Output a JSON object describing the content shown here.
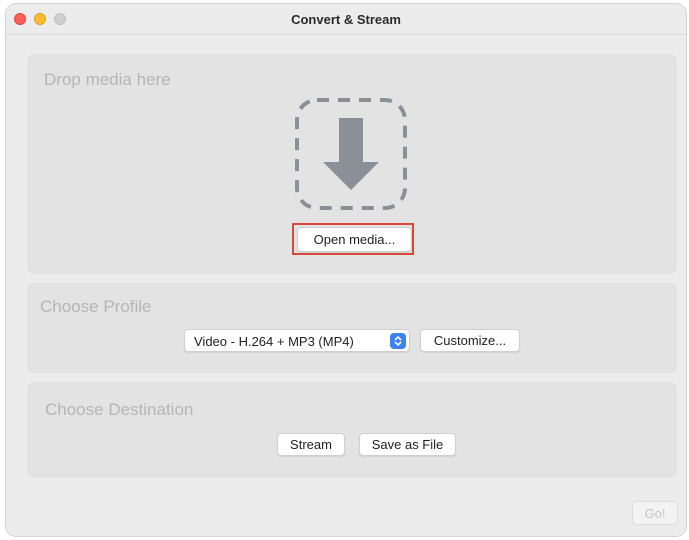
{
  "window": {
    "title": "Convert & Stream"
  },
  "drop_panel": {
    "heading": "Drop media here",
    "open_button_label": "Open media..."
  },
  "profile_panel": {
    "heading": "Choose Profile",
    "selected_profile": "Video - H.264 + MP3 (MP4)",
    "customize_label": "Customize..."
  },
  "destination_panel": {
    "heading": "Choose Destination",
    "stream_label": "Stream",
    "save_label": "Save as File"
  },
  "footer": {
    "go_label": "Go!"
  },
  "icons": {
    "drop_target": "download-arrow-icon",
    "select_stepper": "chevron-updown-icon"
  },
  "colors": {
    "highlight": "#d9473b",
    "stepper_accent": "#3b82f6"
  }
}
